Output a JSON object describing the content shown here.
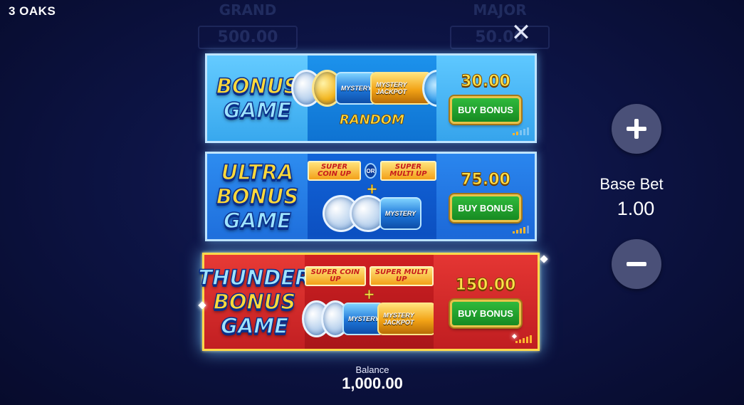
{
  "header": {
    "game_title": "3 OAKS"
  },
  "background_jackpots": [
    {
      "label": "GRAND",
      "value": "500.00"
    },
    {
      "label": "MAJOR",
      "value": "50.00"
    }
  ],
  "panels": [
    {
      "title_lines": [
        "BONUS",
        "GAME"
      ],
      "art_caption": "RANDOM",
      "drum_labels": [
        "MYSTERY",
        "MYSTERY JACKPOT"
      ],
      "price": "30.00",
      "button_label": "BUY BONUS",
      "volatility_level": 2
    },
    {
      "title_lines": [
        "ULTRA",
        "BONUS",
        "GAME"
      ],
      "tags": [
        "SUPER COIN UP",
        "SUPER MULTI UP"
      ],
      "or_label": "OR",
      "plus": "+",
      "drum_labels": [
        "MYSTERY"
      ],
      "price": "75.00",
      "button_label": "BUY BONUS",
      "volatility_level": 4
    },
    {
      "title_lines": [
        "THUNDER",
        "BONUS",
        "GAME"
      ],
      "tags": [
        "SUPER COIN UP",
        "SUPER MULTI UP"
      ],
      "plus": "+",
      "drum_labels": [
        "MYSTERY",
        "MYSTERY JACKPOT"
      ],
      "price": "150.00",
      "button_label": "BUY BONUS",
      "volatility_level": 5
    }
  ],
  "bet": {
    "label": "Base Bet",
    "value": "1.00",
    "plus_symbol": "+",
    "minus_symbol": "−"
  },
  "balance": {
    "label": "Balance",
    "value": "1,000.00"
  },
  "close_symbol": "✕",
  "colors": {
    "gold": "#ffd93a",
    "button_green": "#2fba3c",
    "panel_red": "#c21f22",
    "panel_blue": "#1f6fdc",
    "bg": "#0d1445"
  }
}
